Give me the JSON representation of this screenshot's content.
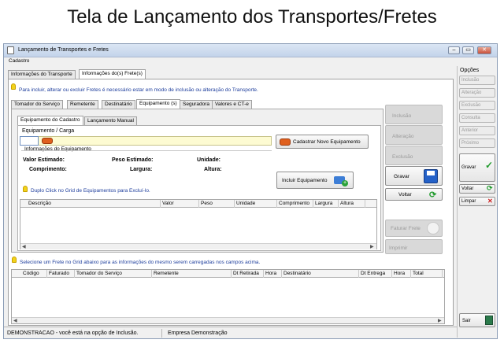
{
  "heading": "Tela de Lançamento dos Transportes/Fretes",
  "window": {
    "title": "Lançamento de Transportes e Fretes",
    "controls": [
      "–",
      "▭",
      "✕"
    ]
  },
  "menu": {
    "cadastro": "Cadastro"
  },
  "top_tabs": [
    "Informações do Transporte",
    "Informações do(s) Frete(s)"
  ],
  "hint_top": "Para incluir, alterar ou excluir Fretes é necessário estar em modo de inclusão ou alteração do Transporte.",
  "sub_tabs": [
    "Tomador do Serviço",
    "Remetente",
    "Destinatário",
    "Equipamento (s)",
    "Seguradora",
    "Valores e CT-e"
  ],
  "equip_tabs": [
    "Equipamento do Cadastro",
    "Lançamento Manual"
  ],
  "equip": {
    "label": "Equipamento / Carga",
    "group_title": "Informações do Equipamento",
    "valor_estimado": "Valor Estimado:",
    "peso_estimado": "Peso Estimado:",
    "unidade": "Unidade:",
    "comprimento": "Comprimento:",
    "largura": "Largura:",
    "altura": "Altura:",
    "btn_cadastrar": "Cadastrar Novo Equipamento",
    "btn_incluir": "Incluir Equipamento",
    "hint_double": "Duplo Click no Grid de Equipamentos para Excluí-lo."
  },
  "equip_grid_columns": [
    "Descrição",
    "Valor",
    "Peso",
    "Unidade",
    "Comprimento",
    "Largura",
    "Altura"
  ],
  "middle_buttons": {
    "inclusao": "Inclusão",
    "alteracao": "Alteração",
    "exclusao": "Exclusão",
    "gravar": "Gravar",
    "voltar": "Voltar",
    "faturar": "Faturar Frete",
    "imprimir": "Imprimir"
  },
  "hint_bottom": "Selecione um Frete no Grid abaixo para as informações do mesmo serem carregadas nos campos acima.",
  "frete_grid_columns": [
    "Código",
    "Faturado",
    "Tomador do Serviço",
    "Remetente",
    "Dt Retirada",
    "Hora",
    "Destinatário",
    "Dt Entrega",
    "Hora",
    "Total"
  ],
  "sidebar": {
    "title": "Opções",
    "items": [
      "Inclusão",
      "Alteração",
      "Exclusão",
      "Consulta",
      "Anterior",
      "Próximo"
    ],
    "gravar": "Gravar",
    "voltar": "Voltar",
    "limpar": "Limpar",
    "sair": "Sair"
  },
  "status": {
    "mode": "DEMONSTRACAO - você está na opção de Inclusão.",
    "empresa": "Empresa Demonstração"
  },
  "colors": {
    "hint_text": "#1d3d9c",
    "green_icon": "#1f9a2b",
    "red_icon": "#cc1b1b",
    "input_yellow": "#fdfbd2",
    "title_gradient": "#c3d3ea"
  }
}
